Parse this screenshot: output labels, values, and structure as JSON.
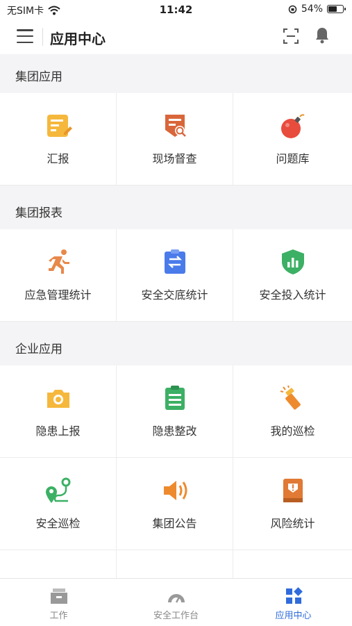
{
  "status_bar": {
    "carrier": "无SIM卡",
    "time": "11:42",
    "battery": "54%",
    "battery_level": 0.54
  },
  "header": {
    "title": "应用中心"
  },
  "sections": [
    {
      "title": "集团应用",
      "items": [
        {
          "label": "汇报",
          "icon": "report-icon",
          "color": "#f5b83d"
        },
        {
          "label": "现场督查",
          "icon": "inspection-badge-icon",
          "color": "#d9663a"
        },
        {
          "label": "问题库",
          "icon": "bomb-icon",
          "color": "#e84c3d"
        }
      ]
    },
    {
      "title": "集团报表",
      "items": [
        {
          "label": "应急管理统计",
          "icon": "running-person-icon",
          "color": "#e8884a"
        },
        {
          "label": "安全交底统计",
          "icon": "clipboard-exchange-icon",
          "color": "#4a7bea"
        },
        {
          "label": "安全投入统计",
          "icon": "shield-chart-icon",
          "color": "#3cb064"
        }
      ]
    },
    {
      "title": "企业应用",
      "items": [
        {
          "label": "隐患上报",
          "icon": "camera-icon",
          "color": "#f5b83d"
        },
        {
          "label": "隐患整改",
          "icon": "checklist-icon",
          "color": "#3cb064"
        },
        {
          "label": "我的巡检",
          "icon": "flashlight-icon",
          "color": "#ee8a2e"
        },
        {
          "label": "安全巡检",
          "icon": "route-pin-icon",
          "color": "#3cb064"
        },
        {
          "label": "集团公告",
          "icon": "speaker-icon",
          "color": "#ee8a2e"
        },
        {
          "label": "风险统计",
          "icon": "warning-book-icon",
          "color": "#e07a34"
        }
      ]
    }
  ],
  "tabbar": [
    {
      "label": "工作",
      "icon": "inbox-tray-icon",
      "active": false
    },
    {
      "label": "安全工作台",
      "icon": "gauge-icon",
      "active": false
    },
    {
      "label": "应用中心",
      "icon": "app-grid-icon",
      "active": true
    }
  ],
  "colors": {
    "accent": "#2f6bdc",
    "background": "#f4f4f6"
  }
}
